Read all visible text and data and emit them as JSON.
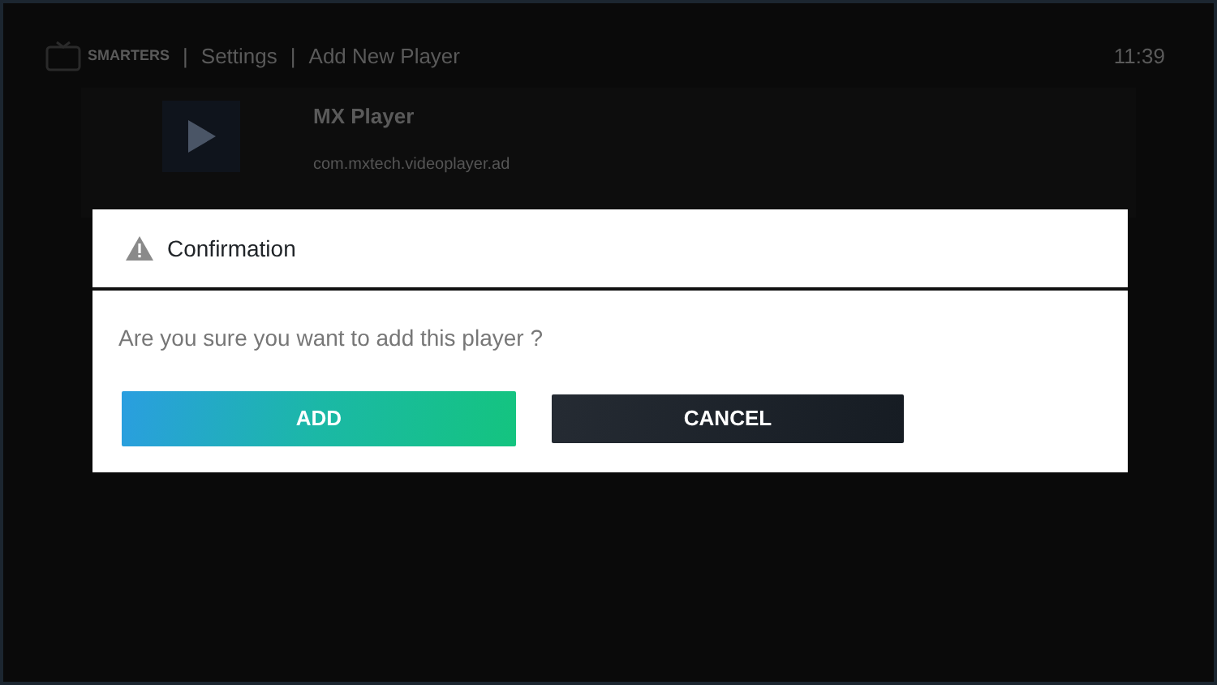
{
  "header": {
    "logo_text": "SMARTERS",
    "separator": "|",
    "breadcrumb": [
      {
        "label": "Settings"
      },
      {
        "label": "Add New Player"
      }
    ],
    "time": "11:39"
  },
  "player": {
    "name": "MX Player",
    "package": "com.mxtech.videoplayer.ad"
  },
  "dialog": {
    "title": "Confirmation",
    "message": "Are you sure you want to add this player ?",
    "buttons": [
      {
        "label": "ADD",
        "kind": "primary"
      },
      {
        "label": "CANCEL",
        "kind": "secondary"
      }
    ]
  }
}
